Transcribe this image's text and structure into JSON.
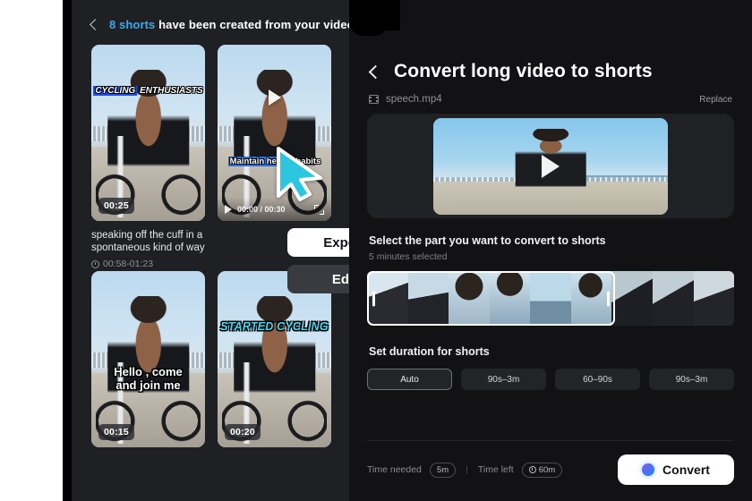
{
  "left_panel": {
    "back_icon": "chevron-left-icon",
    "title_accent": "8 shorts",
    "title_rest": "have been created from your video",
    "shorts": [
      {
        "duration": "00:25",
        "caption_line1": "CYCLING",
        "caption_line2": "ENTHUSIASTS",
        "description": "speaking off the cuff in a spontaneous kind of way",
        "range": "00:58-01:23"
      },
      {
        "duration": "00:30",
        "caption_line1": "Maintain health",
        "caption_line2": "habits",
        "player_time": "00:00 / 00:30",
        "play_icon": "play-icon",
        "fullscreen_icon": "fullscreen-icon"
      },
      {
        "duration": "00:15",
        "caption_line1": "Hello , come",
        "caption_line2": "and join me"
      },
      {
        "duration": "00:20",
        "caption_line1": "STARTED CYCLING",
        "caption_line2": ""
      }
    ],
    "actions": {
      "export_label": "Export",
      "edit_label": "Edit"
    }
  },
  "right_panel": {
    "back_icon": "chevron-left-icon",
    "title": "Convert long video to shorts",
    "file": {
      "icon": "film-icon",
      "name": "speech.mp4",
      "replace_label": "Replace"
    },
    "preview": {
      "play_icon": "play-icon"
    },
    "select_section": {
      "title": "Select the part you want to convert to shorts",
      "subtitle": "5 minutes selected"
    },
    "duration_section": {
      "title": "Set duration for shorts",
      "options": [
        {
          "label": "Auto",
          "active": true
        },
        {
          "label": "90s–3m",
          "active": false
        },
        {
          "label": "60–90s",
          "active": false
        },
        {
          "label": "90s–3m",
          "active": false
        }
      ]
    },
    "footer": {
      "time_needed_label": "Time needed",
      "time_needed_value": "5m",
      "separator": "|",
      "time_left_label": "Time left",
      "time_left_value": "60m",
      "clock_icon": "clock-icon",
      "convert_label": "Convert",
      "convert_icon": "ai-sphere-icon"
    }
  },
  "cursor": {
    "icon": "cursor-arrow-icon",
    "color": "#2cc6e0"
  },
  "colors": {
    "accent_blue": "#3ea9e8",
    "panel_left_bg": "#1f2023",
    "panel_right_bg": "#121214",
    "white": "#ffffff"
  }
}
